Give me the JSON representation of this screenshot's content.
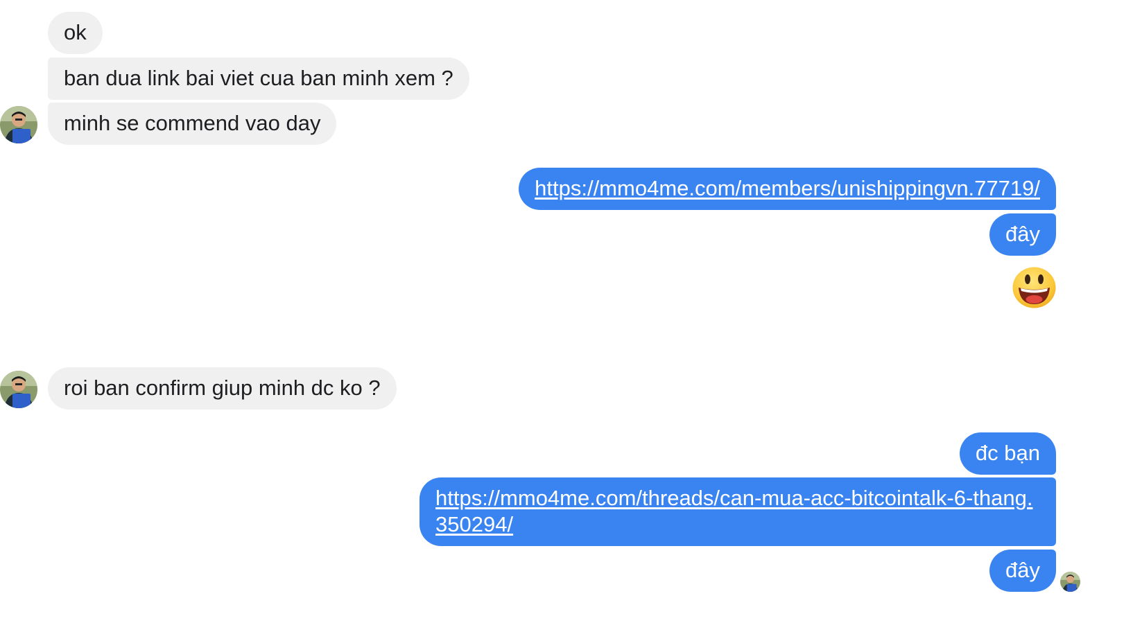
{
  "conversation": {
    "messages": [
      {
        "id": "m1",
        "sender": "other",
        "text": "ok"
      },
      {
        "id": "m2",
        "sender": "other",
        "text": "ban dua link bai viet cua ban minh xem ?"
      },
      {
        "id": "m3",
        "sender": "other",
        "text": "minh se commend vao day"
      },
      {
        "id": "m4",
        "sender": "self",
        "text": "https://mmo4me.com/members/unishippingvn.77719/",
        "type": "link"
      },
      {
        "id": "m5",
        "sender": "self",
        "text": "đây"
      },
      {
        "id": "m6",
        "sender": "self",
        "type": "emoji",
        "icon": "grinning-face-emoji"
      },
      {
        "id": "m7",
        "sender": "other",
        "text": "roi ban confirm giup minh dc ko ?"
      },
      {
        "id": "m8",
        "sender": "self",
        "text": "đc bạn"
      },
      {
        "id": "m9",
        "sender": "self",
        "text": "https://mmo4me.com/threads/can-mua-acc-bitcointalk-6-thang.350294/",
        "type": "link"
      },
      {
        "id": "m10",
        "sender": "self",
        "text": "đây"
      }
    ]
  },
  "colors": {
    "incoming_bubble": "#f1f0f0",
    "outgoing_bubble": "#3a84f2",
    "incoming_text": "#1c1e21",
    "outgoing_text": "#ffffff"
  }
}
